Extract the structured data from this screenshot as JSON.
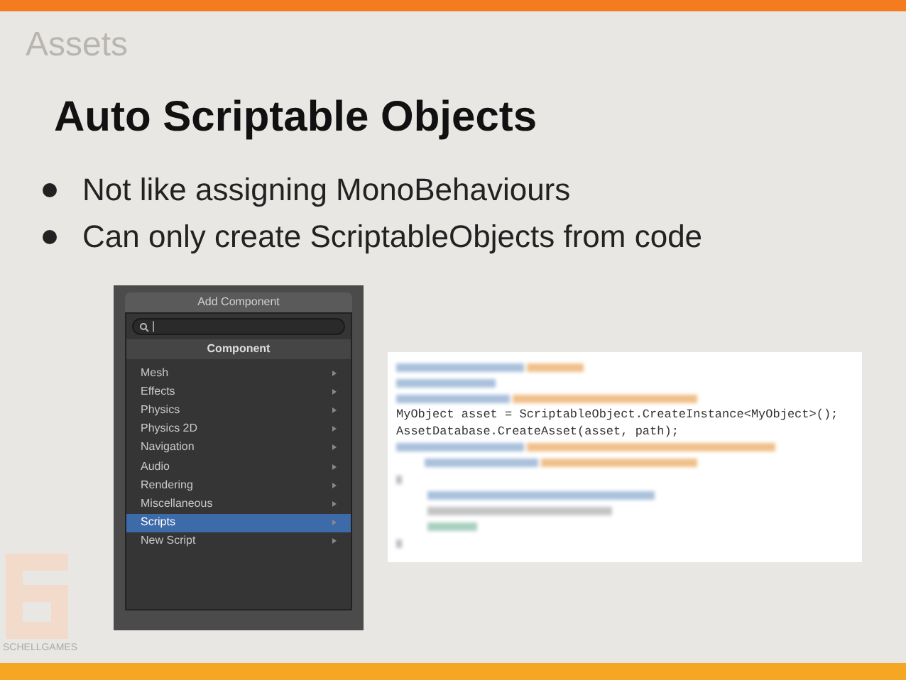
{
  "section": "Assets",
  "title": "Auto Scriptable Objects",
  "bullets": [
    "Not like assigning MonoBehaviours",
    "Can only create ScriptableObjects from code"
  ],
  "add_component": {
    "header": "Add Component",
    "search": {
      "value": "|"
    },
    "category": "Component",
    "items": [
      {
        "label": "Mesh",
        "selected": false
      },
      {
        "label": "Effects",
        "selected": false
      },
      {
        "label": "Physics",
        "selected": false
      },
      {
        "label": "Physics 2D",
        "selected": false
      },
      {
        "label": "Navigation",
        "selected": false
      },
      {
        "label": "Audio",
        "selected": false
      },
      {
        "label": "Rendering",
        "selected": false
      },
      {
        "label": "Miscellaneous",
        "selected": false
      },
      {
        "label": "Scripts",
        "selected": true
      },
      {
        "label": "New Script",
        "selected": false
      }
    ]
  },
  "code": {
    "lines": [
      "MyObject asset = ScriptableObject.CreateInstance<MyObject>();",
      "AssetDatabase.CreateAsset(asset, path);"
    ]
  },
  "logo": {
    "text": "SCHELLGAMES"
  }
}
